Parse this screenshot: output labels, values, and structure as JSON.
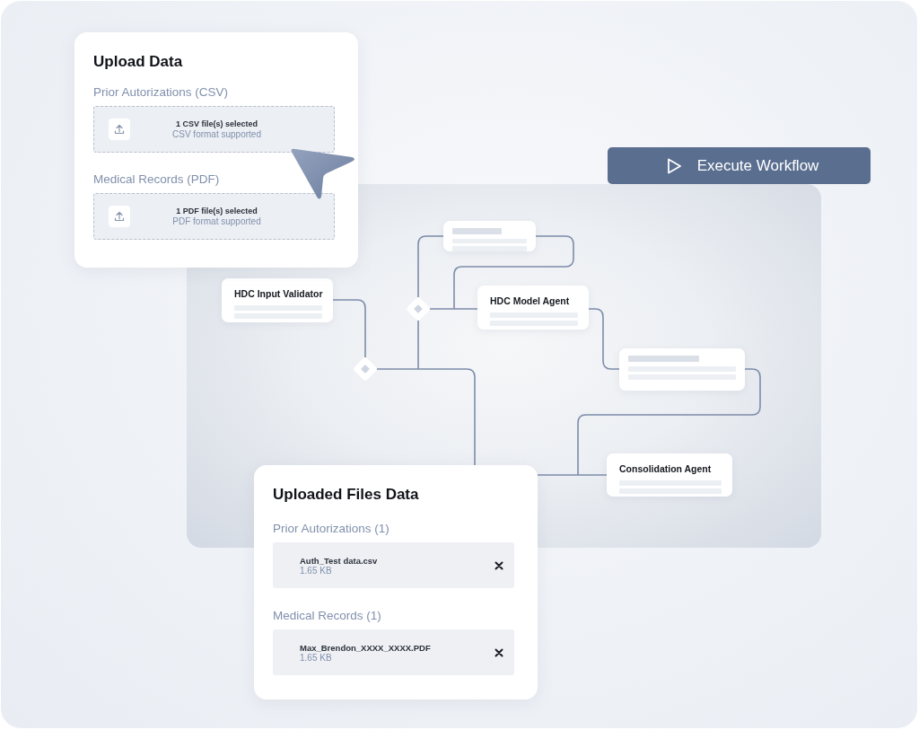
{
  "upload_card": {
    "title": "Upload Data",
    "sections": [
      {
        "label": "Prior Autorizations (CSV)",
        "status": "1 CSV file(s) selected",
        "hint": "CSV format supported"
      },
      {
        "label": "Medical Records (PDF)",
        "status": "1 PDF file(s) selected",
        "hint": "PDF format supported"
      }
    ]
  },
  "execute_button": {
    "label": "Execute Workflow"
  },
  "workflow_nodes": [
    {
      "title": "HDC Input Validator"
    },
    {
      "title": "HDC Model Agent"
    },
    {
      "title": "Consolidation Agent"
    }
  ],
  "uploaded_card": {
    "title": "Uploaded Files Data",
    "groups": [
      {
        "label": "Prior Autorizations (1)",
        "files": [
          {
            "name": "Auth_Test data.csv",
            "size": "1.65 KB"
          }
        ]
      },
      {
        "label": "Medical Records (1)",
        "files": [
          {
            "name": "Max_Brendon_XXXX_XXXX.PDF",
            "size": "1.65 KB"
          }
        ]
      }
    ]
  }
}
